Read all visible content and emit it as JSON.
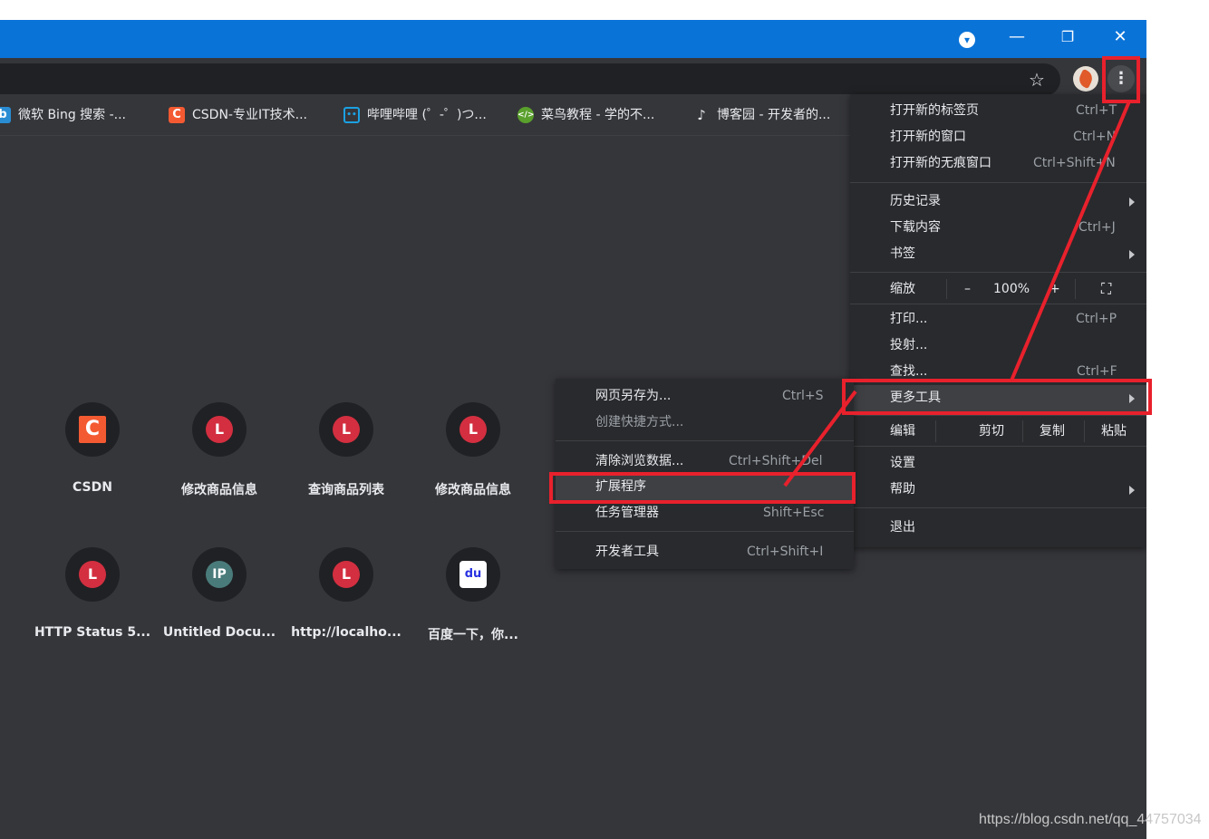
{
  "window": {
    "controls": {
      "minimize": "—",
      "restore": "❐",
      "close": "✕",
      "tab_search": "▾"
    }
  },
  "toolbar": {
    "star_icon": "☆",
    "menu_icon": "⋮"
  },
  "bookmarks": [
    {
      "label": "微软 Bing 搜索 -...",
      "icon": "bing-icon",
      "color": "#2a8dd4"
    },
    {
      "label": "CSDN-专业IT技术...",
      "icon": "csdn-icon",
      "color": "#f45a32"
    },
    {
      "label": "哔哩哔哩 (゜-゜)つ...",
      "icon": "bilibili-icon",
      "color": "#1ba1e2"
    },
    {
      "label": "菜鸟教程 - 学的不...",
      "icon": "runoob-icon",
      "color": "#5aa02c"
    },
    {
      "label": "博客园 - 开发者的...",
      "icon": "cnblogs-icon",
      "color": "#e8eaed"
    }
  ],
  "shortcuts": [
    {
      "label": "CSDN",
      "letter": "C",
      "color": "#f45a32"
    },
    {
      "label": "修改商品信息",
      "letter": "L",
      "color": "#d32f40"
    },
    {
      "label": "查询商品列表",
      "letter": "L",
      "color": "#d32f40"
    },
    {
      "label": "修改商品信息",
      "letter": "L",
      "color": "#d32f40"
    },
    {
      "label": "HTTP Status 5...",
      "letter": "L",
      "color": "#d32f40"
    },
    {
      "label": "Untitled Docu...",
      "letter": "IP",
      "color": "#4a7b7b"
    },
    {
      "label": "http://localho...",
      "letter": "L",
      "color": "#d32f40"
    },
    {
      "label": "百度一下，你...",
      "letter": "du",
      "color": "#2932e1"
    }
  ],
  "main_menu": {
    "new_tab": {
      "label": "打开新的标签页",
      "shortcut": "Ctrl+T"
    },
    "new_window": {
      "label": "打开新的窗口",
      "shortcut": "Ctrl+N"
    },
    "new_incognito": {
      "label": "打开新的无痕窗口",
      "shortcut": "Ctrl+Shift+N"
    },
    "history": {
      "label": "历史记录"
    },
    "downloads": {
      "label": "下载内容",
      "shortcut": "Ctrl+J"
    },
    "bookmarks": {
      "label": "书签"
    },
    "zoom": {
      "label": "缩放",
      "minus": "–",
      "value": "100%",
      "plus": "+",
      "fullscreen": "⛶"
    },
    "print": {
      "label": "打印...",
      "shortcut": "Ctrl+P"
    },
    "cast": {
      "label": "投射..."
    },
    "find": {
      "label": "查找...",
      "shortcut": "Ctrl+F"
    },
    "more_tools": {
      "label": "更多工具"
    },
    "edit": {
      "label": "编辑",
      "cut": "剪切",
      "copy": "复制",
      "paste": "粘贴"
    },
    "settings": {
      "label": "设置"
    },
    "help": {
      "label": "帮助"
    },
    "exit": {
      "label": "退出"
    }
  },
  "submenu": {
    "save_page": {
      "label": "网页另存为...",
      "shortcut": "Ctrl+S"
    },
    "create_shortcut": {
      "label": "创建快捷方式..."
    },
    "clear_data": {
      "label": "清除浏览数据...",
      "shortcut": "Ctrl+Shift+Del"
    },
    "extensions": {
      "label": "扩展程序"
    },
    "task_manager": {
      "label": "任务管理器",
      "shortcut": "Shift+Esc"
    },
    "dev_tools": {
      "label": "开发者工具",
      "shortcut": "Ctrl+Shift+I"
    }
  },
  "watermark": "https://blog.csdn.net/qq_44757034",
  "annotation_color": "#e8212c"
}
